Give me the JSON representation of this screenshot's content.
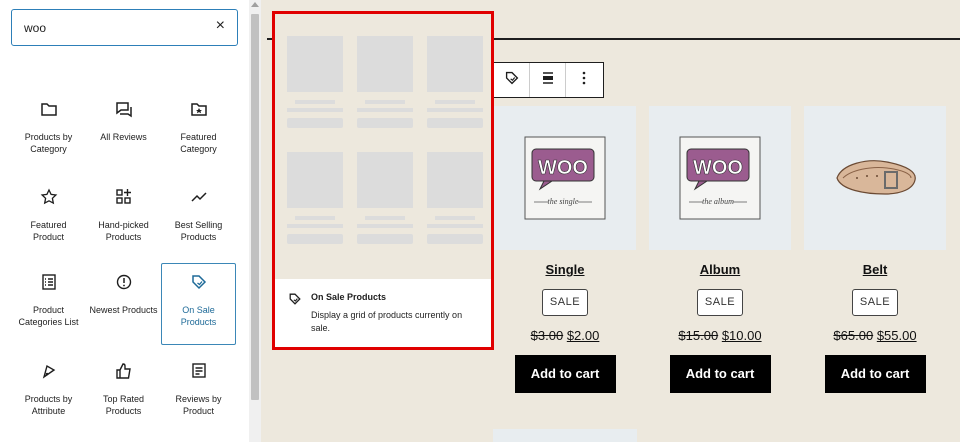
{
  "inserter": {
    "search_value": "woo",
    "clear_symbol": "×",
    "blocks": [
      {
        "label": "Products by Category",
        "icon": "folder-icon"
      },
      {
        "label": "All Reviews",
        "icon": "comments-icon"
      },
      {
        "label": "Featured Category",
        "icon": "folder-star-icon"
      },
      {
        "label": "Featured Product",
        "icon": "star-icon"
      },
      {
        "label": "Hand-picked Products",
        "icon": "grid-plus-icon"
      },
      {
        "label": "Best Selling Products",
        "icon": "trend-icon"
      },
      {
        "label": "Product Categories List",
        "icon": "list-icon"
      },
      {
        "label": "Newest Products",
        "icon": "alert-circle-icon"
      },
      {
        "label": "On Sale Products",
        "icon": "tag-icon",
        "selected": true
      },
      {
        "label": "Products by Attribute",
        "icon": "attribute-icon"
      },
      {
        "label": "Top Rated Products",
        "icon": "thumbs-up-icon"
      },
      {
        "label": "Reviews by Product",
        "icon": "review-icon"
      }
    ]
  },
  "preview": {
    "title": "On Sale Products",
    "description": "Display a grid of products currently on sale."
  },
  "products": [
    {
      "title": "Single",
      "badge": "SALE",
      "old_price": "$3.00",
      "new_price": "$2.00",
      "cart": "Add to cart",
      "image": "woo-single"
    },
    {
      "title": "Album",
      "badge": "SALE",
      "old_price": "$15.00",
      "new_price": "$10.00",
      "cart": "Add to cart",
      "image": "woo-album"
    },
    {
      "title": "Belt",
      "badge": "SALE",
      "old_price": "$65.00",
      "new_price": "$55.00",
      "cart": "Add to cart",
      "image": "belt"
    }
  ],
  "colors": {
    "accent": "#3b87b7",
    "highlight": "#e00000",
    "canvas": "#ede8dd"
  }
}
